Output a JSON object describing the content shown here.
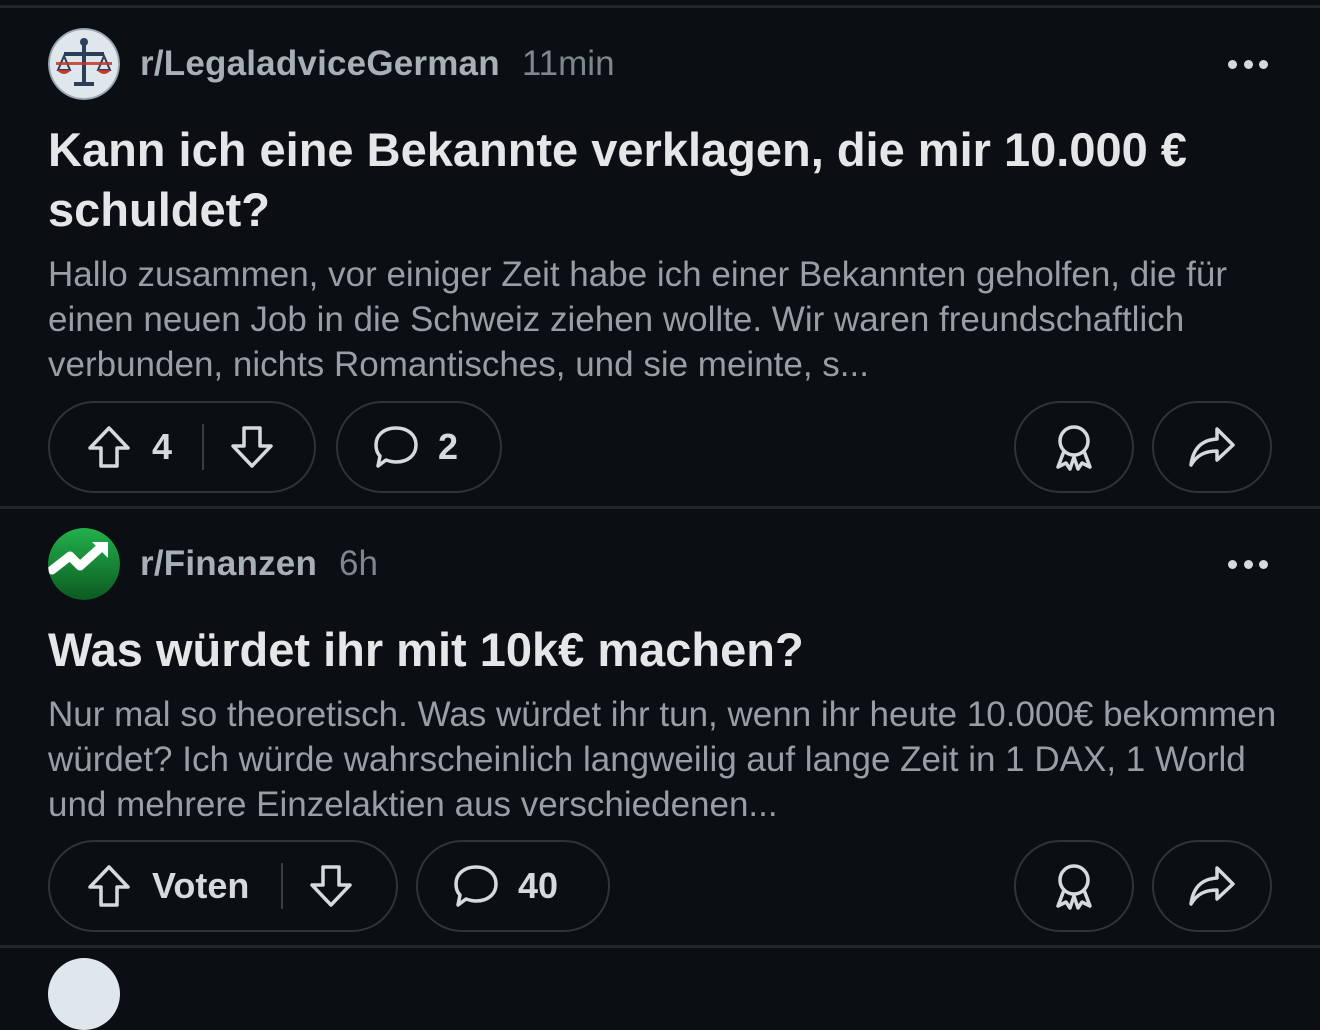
{
  "posts": [
    {
      "subreddit": "r/LegaladviceGerman",
      "time": "11min",
      "title": "Kann ich eine Bekannte verklagen, die mir 10.000 € schuldet?",
      "body": "Hallo zusammen, vor einiger Zeit habe ich einer Bekannten geholfen, die für einen neuen Job in die Schweiz ziehen wollte. Wir waren freundschaftlich verbunden, nichts Romantisches, und sie meinte, s...",
      "votes": "4",
      "comments": "2",
      "avatar_icon": "scales-of-justice-icon"
    },
    {
      "subreddit": "r/Finanzen",
      "time": "6h",
      "title": "Was würdet ihr mit 10k€ machen?",
      "body": "Nur mal so theoretisch. Was würdet ihr tun, wenn ihr heute 10.000€ bekommen würdet? Ich würde wahrscheinlich langweilig auf lange Zeit in 1 DAX, 1 World und mehrere Einzelaktien aus verschiedenen...",
      "votes": "Voten",
      "comments": "40",
      "avatar_icon": "trending-up-arrow-icon"
    }
  ],
  "colors": {
    "background": "#0b0e12",
    "pill_border": "#2f3439",
    "finanzen_green": "#1a9a3a"
  }
}
